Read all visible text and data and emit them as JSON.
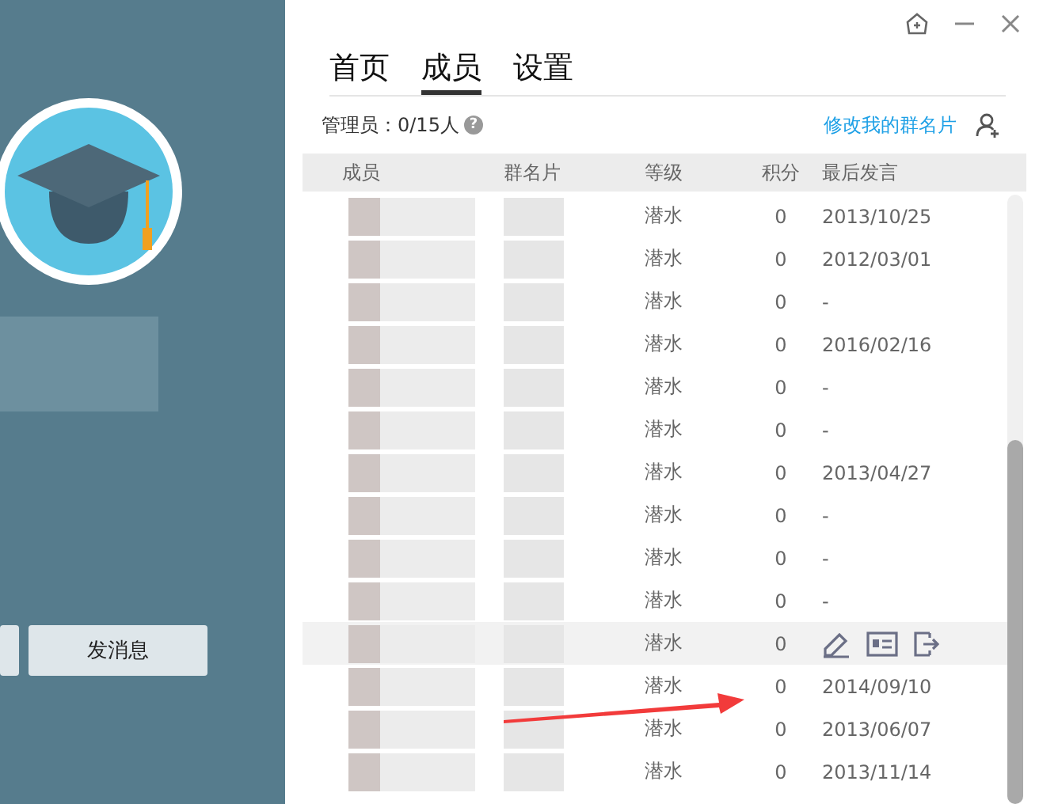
{
  "sidebar": {
    "send_button": "发消息"
  },
  "tabs": [
    {
      "label": "首页",
      "selected": false
    },
    {
      "label": "成员",
      "selected": true
    },
    {
      "label": "设置",
      "selected": false
    }
  ],
  "admin_count": "管理员：0/15人",
  "help_icon": "?",
  "edit_card_link": "修改我的群名片",
  "table": {
    "columns": [
      "成员",
      "群名片",
      "等级",
      "积分",
      "最后发言"
    ],
    "rows": [
      {
        "level": "潜水",
        "points": "0",
        "last_post": "2013/10/25",
        "hovered": false
      },
      {
        "level": "潜水",
        "points": "0",
        "last_post": "2012/03/01",
        "hovered": false
      },
      {
        "level": "潜水",
        "points": "0",
        "last_post": "-",
        "hovered": false
      },
      {
        "level": "潜水",
        "points": "0",
        "last_post": "2016/02/16",
        "hovered": false
      },
      {
        "level": "潜水",
        "points": "0",
        "last_post": "-",
        "hovered": false
      },
      {
        "level": "潜水",
        "points": "0",
        "last_post": "-",
        "hovered": false
      },
      {
        "level": "潜水",
        "points": "0",
        "last_post": "2013/04/27",
        "hovered": false
      },
      {
        "level": "潜水",
        "points": "0",
        "last_post": "-",
        "hovered": false
      },
      {
        "level": "潜水",
        "points": "0",
        "last_post": "-",
        "hovered": false
      },
      {
        "level": "潜水",
        "points": "0",
        "last_post": "-",
        "hovered": false
      },
      {
        "level": "潜水",
        "points": "0",
        "hovered": true
      },
      {
        "level": "潜水",
        "points": "0",
        "last_post": "2014/09/10",
        "hovered": false
      },
      {
        "level": "潜水",
        "points": "0",
        "last_post": "2013/06/07",
        "hovered": false
      },
      {
        "level": "潜水",
        "points": "0",
        "last_post": "2013/11/14",
        "hovered": false
      }
    ]
  }
}
